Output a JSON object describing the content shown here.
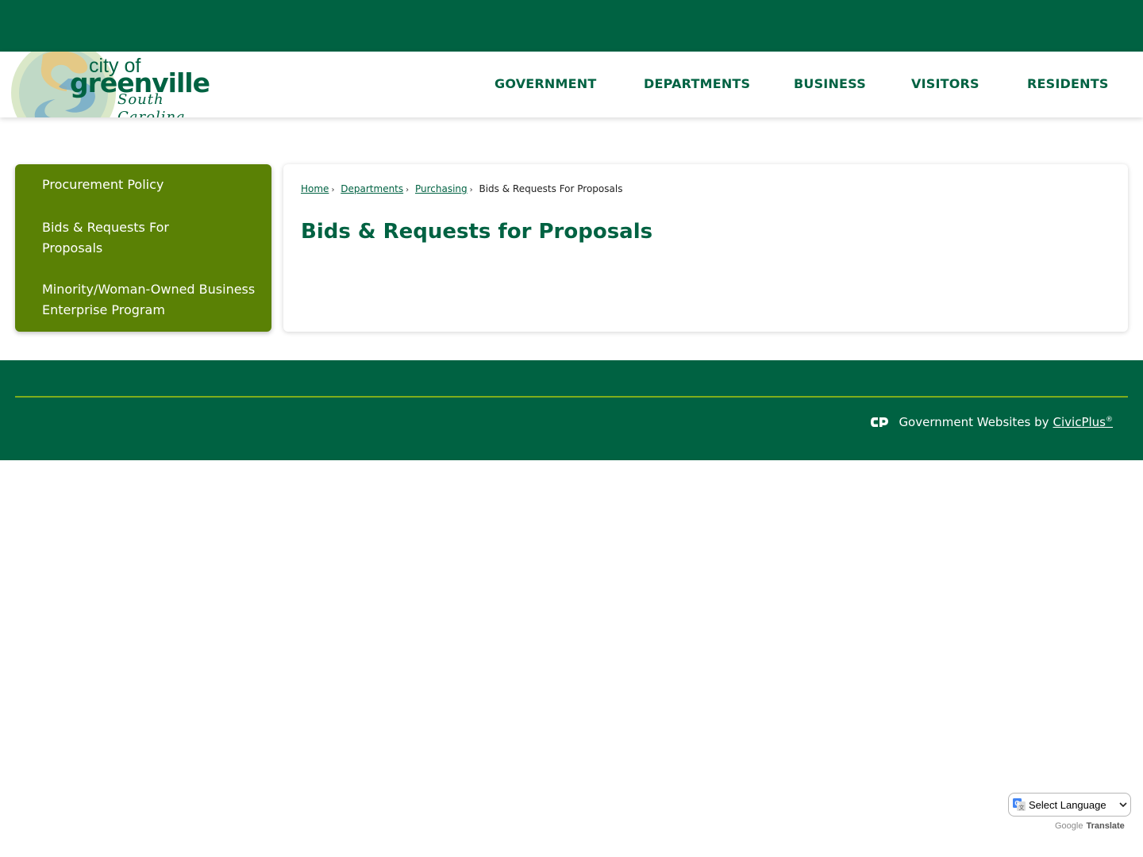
{
  "brand": {
    "city_of": "city of",
    "name": "greenville",
    "state": "South Carolina"
  },
  "nav": {
    "items": [
      "GOVERNMENT",
      "DEPARTMENTS",
      "BUSINESS",
      "VISITORS",
      "RESIDENTS"
    ]
  },
  "sidebar": {
    "items": [
      "Procurement Policy",
      "Bids & Requests For Proposals",
      "Minority/Woman-Owned Business Enterprise Program"
    ]
  },
  "breadcrumb": {
    "home": "Home",
    "departments": "Departments",
    "purchasing": "Purchasing",
    "current": "Bids & Requests For Proposals",
    "separator": "›"
  },
  "page": {
    "title": "Bids & Requests for Proposals"
  },
  "footer": {
    "credit_prefix": "Government Websites by",
    "credit_link": "CivicPlus",
    "registered": "®"
  },
  "translate": {
    "label": "Select Language",
    "powered_google": "Google",
    "powered_translate": "Translate"
  },
  "colors": {
    "brand_green": "#006242",
    "sidebar_green": "#5a8105",
    "footer_rule": "#7fae1c"
  }
}
